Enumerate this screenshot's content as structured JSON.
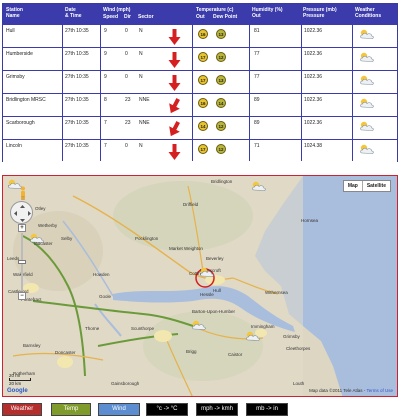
{
  "table": {
    "headers": {
      "station": "Station\nName",
      "date": "Date\n& Time",
      "wind": "Wind (mph)",
      "speed": "Speed",
      "dir": "Dir",
      "sector": "Sector",
      "temperature": "Temperature (c)",
      "out": "Out",
      "dewpoint": "Dew Point",
      "humidity": "Humidity (%)\nOut",
      "pressure": "Pressure (mb)\nPressure",
      "conditions": "Weather\nConditions"
    },
    "rows": [
      {
        "station": "Hull",
        "date": "27th 10:35",
        "speed": "9",
        "dir": "0",
        "sector": "N",
        "temp": "16",
        "dew": "13",
        "humidity": "81",
        "pressure": "1022.36"
      },
      {
        "station": "Humberside",
        "date": "27th 10:35",
        "speed": "9",
        "dir": "0",
        "sector": "N",
        "temp": "17",
        "dew": "12",
        "humidity": "77",
        "pressure": "1022.36"
      },
      {
        "station": "Grimsby",
        "date": "27th 10:35",
        "speed": "9",
        "dir": "0",
        "sector": "N",
        "temp": "17",
        "dew": "13",
        "humidity": "77",
        "pressure": "1022.36"
      },
      {
        "station": "Bridlington MRSC",
        "date": "27th 10:35",
        "speed": "8",
        "dir": "23",
        "sector": "NNE",
        "temp": "16",
        "dew": "14",
        "humidity": "89",
        "pressure": "1022.36"
      },
      {
        "station": "Scarborough",
        "date": "27th 10:35",
        "speed": "7",
        "dir": "23",
        "sector": "NNE",
        "temp": "14",
        "dew": "12",
        "humidity": "89",
        "pressure": "1022.36"
      },
      {
        "station": "Lincoln",
        "date": "27th 10:35",
        "speed": "7",
        "dir": "0",
        "sector": "N",
        "temp": "17",
        "dew": "12",
        "humidity": "71",
        "pressure": "1024.38"
      }
    ]
  },
  "map": {
    "type_map": "Map",
    "type_satellite": "Satellite",
    "attribution": "Map data ©2011 Tele Atlas -",
    "terms": "Terms of Use",
    "scale_top": "20 mi",
    "scale_bottom": "20 km",
    "logo": "Google",
    "places": [
      {
        "name": "Bridlington"
      },
      {
        "name": "Driffield"
      },
      {
        "name": "Hornsea"
      },
      {
        "name": "York"
      },
      {
        "name": "Beverley"
      },
      {
        "name": "Cottingham"
      },
      {
        "name": "Hull"
      },
      {
        "name": "Hessle"
      },
      {
        "name": "Withernsea"
      },
      {
        "name": "Selby"
      },
      {
        "name": "Goole"
      },
      {
        "name": "Pontefract"
      },
      {
        "name": "Castleford"
      },
      {
        "name": "Wakefield"
      },
      {
        "name": "Scunthorpe"
      },
      {
        "name": "Barton-Upon-Humber"
      },
      {
        "name": "Brigg"
      },
      {
        "name": "Grimsby"
      },
      {
        "name": "Cleethorpes"
      },
      {
        "name": "Immingham"
      },
      {
        "name": "Doncaster"
      },
      {
        "name": "Gainsborough"
      },
      {
        "name": "Rotherham"
      },
      {
        "name": "Market Weighton"
      },
      {
        "name": "Pocklington"
      },
      {
        "name": "Howden"
      },
      {
        "name": "Tadcaster"
      },
      {
        "name": "Wetherby"
      },
      {
        "name": "Leeds"
      },
      {
        "name": "Otley"
      },
      {
        "name": "Caistor"
      },
      {
        "name": "Louth"
      },
      {
        "name": "Molescroft"
      },
      {
        "name": "Barnsley"
      },
      {
        "name": "Thorne"
      }
    ]
  },
  "buttons": {
    "weather": "Weather",
    "temp": "Temp",
    "wind": "Wind",
    "c_to_f": "°c -> °C",
    "mph_to_kmh": "mph -> kmh",
    "mb_to_in": "mb -> in"
  },
  "colors": {
    "header": "#3b3bab",
    "arrow": "#d42020",
    "temp_badge": "#e7c42d",
    "dew_badge": "#b7b53a"
  }
}
